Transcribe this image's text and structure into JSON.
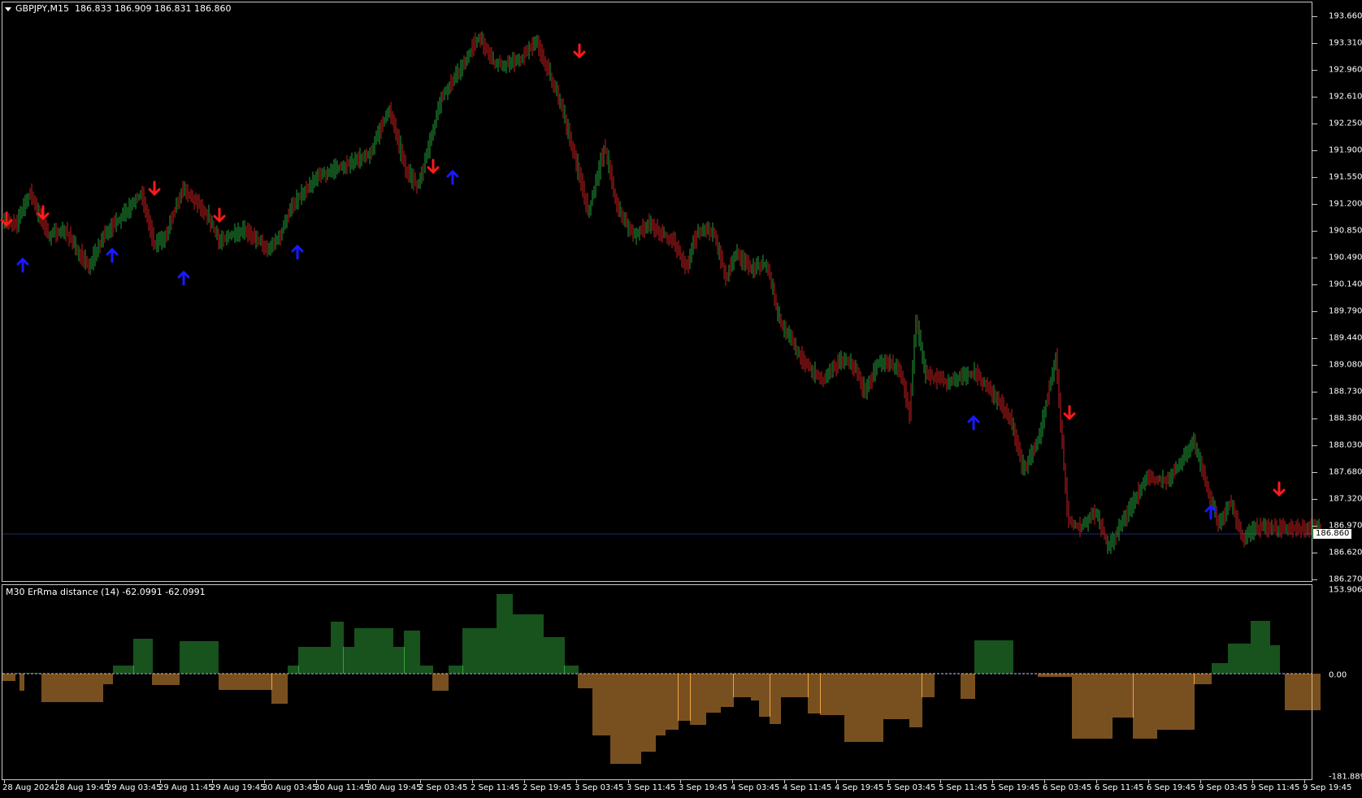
{
  "chart": {
    "symbol_header": "GBPJPY,M15",
    "ohlc": "186.833 186.909 186.831 186.860",
    "current_price": "186.860",
    "price_axis": [
      "193.660",
      "193.310",
      "192.960",
      "192.610",
      "192.250",
      "191.900",
      "191.550",
      "191.200",
      "190.850",
      "190.490",
      "190.140",
      "189.790",
      "189.440",
      "189.080",
      "188.730",
      "188.380",
      "188.030",
      "187.680",
      "187.320",
      "186.970",
      "186.620",
      "186.270"
    ],
    "time_axis": [
      "28 Aug 2024",
      "28 Aug 19:45",
      "29 Aug 03:45",
      "29 Aug 11:45",
      "29 Aug 19:45",
      "30 Aug 03:45",
      "30 Aug 11:45",
      "30 Aug 19:45",
      "2 Sep 03:45",
      "2 Sep 11:45",
      "2 Sep 19:45",
      "3 Sep 03:45",
      "3 Sep 11:45",
      "3 Sep 19:45",
      "4 Sep 03:45",
      "4 Sep 11:45",
      "4 Sep 19:45",
      "5 Sep 03:45",
      "5 Sep 11:45",
      "5 Sep 19:45",
      "6 Sep 03:45",
      "6 Sep 11:45",
      "6 Sep 19:45",
      "9 Sep 03:45",
      "9 Sep 11:45",
      "9 Sep 19:45"
    ],
    "colors": {
      "bull": "#22a03a",
      "bear": "#c81e1e",
      "up_arrow": "#1a1aff",
      "down_arrow": "#ff1a1a",
      "bid_line": "#1e2a78"
    }
  },
  "indicator": {
    "label": "M30 ErRma distance (14) -62.0991 -62.0991",
    "axis_top": "153.9061",
    "axis_zero": "0.00",
    "axis_bottom": "-181.8893",
    "colors": {
      "positive": "#2fa43a",
      "negative": "#f0a040",
      "baseline": "#c9c9ff"
    }
  }
}
